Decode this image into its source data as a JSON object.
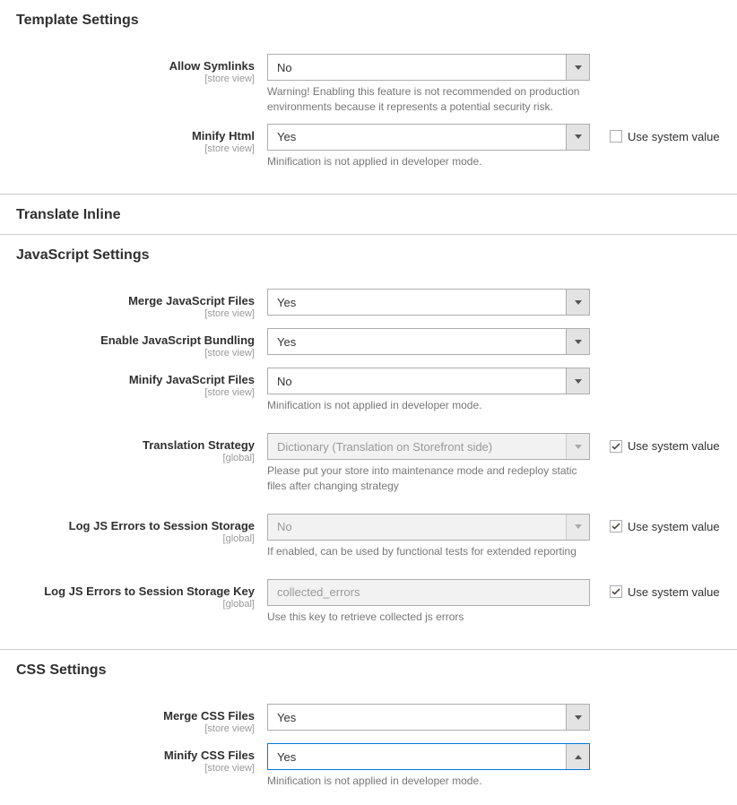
{
  "common": {
    "scope_store": "[store view]",
    "scope_global": "[global]",
    "use_system": "Use system value",
    "minify_note": "Minification is not applied in developer mode."
  },
  "template": {
    "title": "Template Settings",
    "allow_symlinks": {
      "label": "Allow Symlinks",
      "value": "No",
      "note": "Warning! Enabling this feature is not recommended on production environments because it represents a potential security risk."
    },
    "minify_html": {
      "label": "Minify Html",
      "value": "Yes"
    }
  },
  "translate": {
    "title": "Translate Inline"
  },
  "js": {
    "title": "JavaScript Settings",
    "merge": {
      "label": "Merge JavaScript Files",
      "value": "Yes"
    },
    "bundling": {
      "label": "Enable JavaScript Bundling",
      "value": "Yes"
    },
    "minify": {
      "label": "Minify JavaScript Files",
      "value": "No"
    },
    "translation": {
      "label": "Translation Strategy",
      "value": "Dictionary (Translation on Storefront side)",
      "note": "Please put your store into maintenance mode and redeploy static files after changing strategy"
    },
    "log_errors": {
      "label": "Log JS Errors to Session Storage",
      "value": "No",
      "note": "If enabled, can be used by functional tests for extended reporting"
    },
    "log_errors_key": {
      "label": "Log JS Errors to Session Storage Key",
      "value": "collected_errors",
      "note": "Use this key to retrieve collected js errors"
    }
  },
  "css": {
    "title": "CSS Settings",
    "merge": {
      "label": "Merge CSS Files",
      "value": "Yes"
    },
    "minify": {
      "label": "Minify CSS Files",
      "value": "Yes"
    }
  }
}
